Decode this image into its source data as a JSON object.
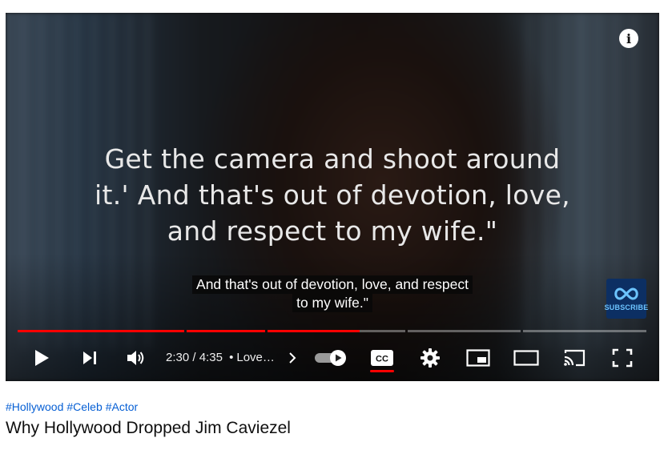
{
  "video": {
    "burned_caption": [
      "Get the camera and shoot around",
      "it.' And that's out of devotion, love,",
      "and respect to my wife.\""
    ],
    "subtitles": [
      "And that's out of devotion, love, and respect",
      "to my wife.\""
    ],
    "channel_logo_text": "SUBSCRIBE"
  },
  "controls": {
    "time_current": "2:30",
    "time_separator": "/",
    "time_total": "4:35",
    "chapter_dot": "•",
    "chapter_label": "Love…",
    "captions_label": "CC",
    "progress_fraction": 0.545,
    "autoplay_on": true,
    "icons": [
      "play-icon",
      "next-icon",
      "volume-icon",
      "chevron-right-icon",
      "autoplay-toggle",
      "cc-icon",
      "gear-icon",
      "miniplayer-icon",
      "theater-icon",
      "cast-icon",
      "fullscreen-icon",
      "info-icon"
    ]
  },
  "below_video": {
    "hashtags": [
      "#Hollywood",
      "#Celeb",
      "#Actor"
    ],
    "title": "Why Hollywood Dropped Jim Caviezel"
  },
  "colors": {
    "accent_red": "#ff0000",
    "hashtag_blue": "#065fd4"
  }
}
